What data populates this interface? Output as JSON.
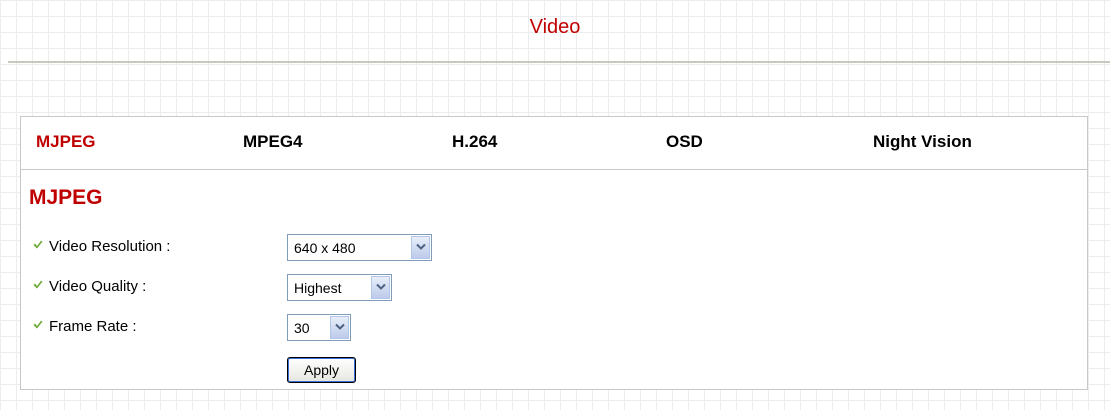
{
  "page": {
    "title": "Video"
  },
  "tabs": [
    {
      "label": "MJPEG",
      "active": true
    },
    {
      "label": "MPEG4",
      "active": false
    },
    {
      "label": "H.264",
      "active": false
    },
    {
      "label": "OSD",
      "active": false
    },
    {
      "label": "Night Vision",
      "active": false
    }
  ],
  "section": {
    "title": "MJPEG"
  },
  "settings": {
    "resolution": {
      "label": "Video Resolution :",
      "value": "640 x 480"
    },
    "quality": {
      "label": "Video Quality :",
      "value": "Highest"
    },
    "frame_rate": {
      "label": "Frame Rate :",
      "value": "30"
    }
  },
  "apply_label": "Apply",
  "icons": {
    "bullet": "green-check-icon",
    "dropdown": "chevron-down-icon"
  },
  "colors": {
    "accent": "#c00000",
    "check": "#6aa832"
  }
}
